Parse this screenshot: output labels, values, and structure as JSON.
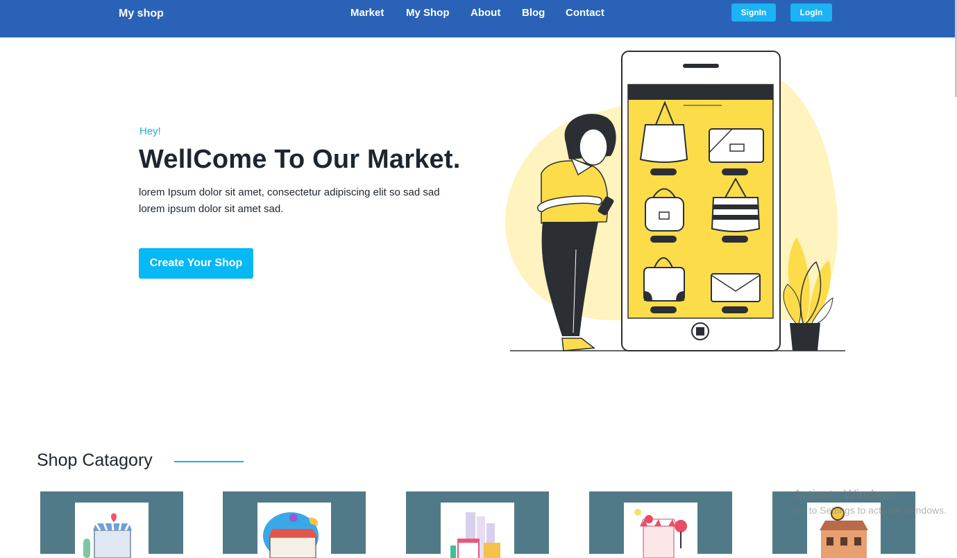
{
  "header": {
    "brand": "My shop",
    "nav": [
      "Market",
      "My Shop",
      "About",
      "Blog",
      "Contact"
    ],
    "signin_label": "SignIn",
    "login_label": "LogIn"
  },
  "hero": {
    "greeting": "Hey!",
    "title": "WellCome To Our Market.",
    "description": "lorem Ipsum dolor sit amet, consectetur adipiscing elit so sad sad lorem ipsum dolor sit amet sad.",
    "cta_label": "Create Your Shop"
  },
  "categories": {
    "title": "Shop Catagory",
    "cards": [
      "shop-icon",
      "store-icon",
      "market-icon",
      "bakery-icon",
      "building-icon"
    ]
  },
  "watermark": {
    "title": "Activate Windows",
    "subtitle": "Go to Settings to activate Windows."
  },
  "colors": {
    "navbar": "#2a62b7",
    "accent": "#06b8f4",
    "card": "#517a88",
    "illustration_yellow": "#fddc4a"
  }
}
